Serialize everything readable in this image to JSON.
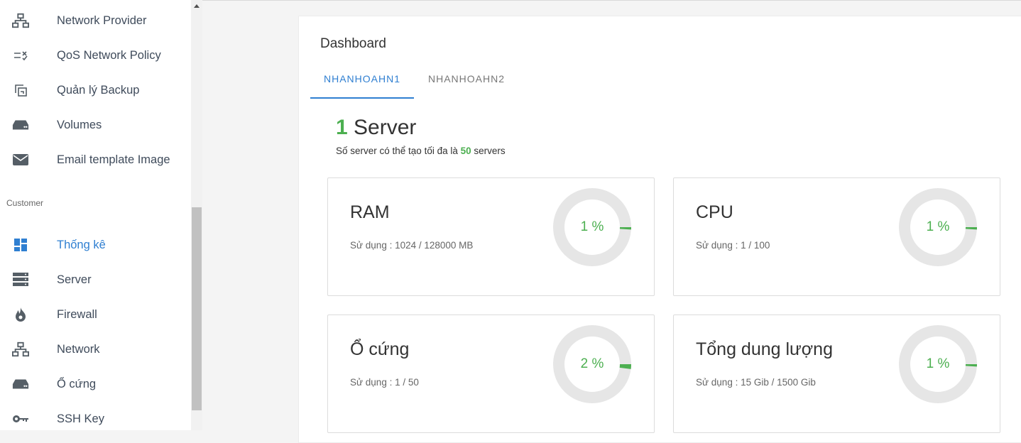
{
  "sidebar": {
    "items_top": [
      {
        "label": "Network Provider",
        "icon": "network-icon"
      },
      {
        "label": "QoS Network Policy",
        "icon": "qos-list-icon"
      },
      {
        "label": "Quản lý Backup",
        "icon": "backup-copy-icon"
      },
      {
        "label": "Volumes",
        "icon": "drive-icon"
      },
      {
        "label": "Email template Image",
        "icon": "envelope-icon"
      }
    ],
    "section_label": "Customer",
    "items_customer": [
      {
        "label": "Thống kê",
        "icon": "dashboard-grid-icon",
        "active": true
      },
      {
        "label": "Server",
        "icon": "server-icon"
      },
      {
        "label": "Firewall",
        "icon": "flame-icon"
      },
      {
        "label": "Network",
        "icon": "network-icon"
      },
      {
        "label": "Ổ cứng",
        "icon": "drive-icon"
      },
      {
        "label": "SSH Key",
        "icon": "key-icon"
      }
    ]
  },
  "main": {
    "title": "Dashboard",
    "tabs": [
      {
        "label": "NHANHOAHN1",
        "active": true
      },
      {
        "label": "NHANHOAHN2",
        "active": false
      }
    ],
    "server_count": "1",
    "server_word": "Server",
    "server_limit_prefix": "Số server có thể tạo tối đa là",
    "server_limit_value": "50",
    "server_limit_suffix": "servers",
    "cards": [
      {
        "title": "RAM",
        "usage": "Sử dụng : 1024 / 128000 MB",
        "percent_label": "1 %",
        "percent": 1
      },
      {
        "title": "CPU",
        "usage": "Sử dụng : 1 / 100",
        "percent_label": "1 %",
        "percent": 1
      },
      {
        "title": "Ổ cứng",
        "usage": "Sử dụng : 1 / 50",
        "percent_label": "2 %",
        "percent": 2
      },
      {
        "title": "Tổng dung lượng",
        "usage": "Sử dụng : 15 Gib / 1500 Gib",
        "percent_label": "1 %",
        "percent": 1
      }
    ]
  },
  "colors": {
    "accent_blue": "#2f7fd1",
    "success_green": "#4caf50",
    "donut_track": "#e6e6e6",
    "icon_gray": "#555e66"
  }
}
